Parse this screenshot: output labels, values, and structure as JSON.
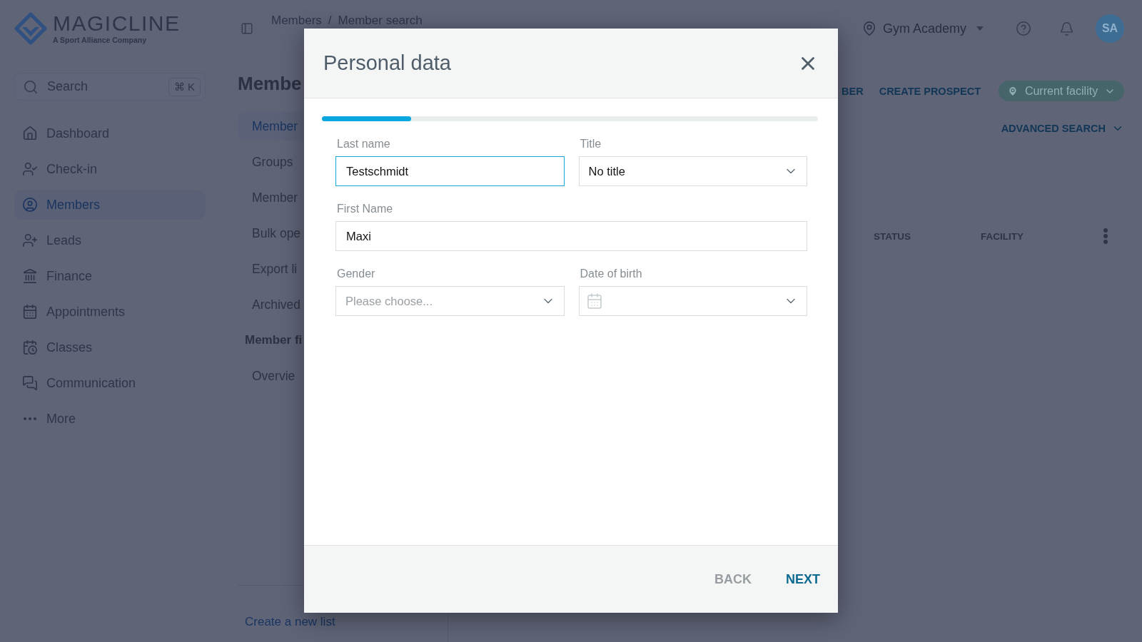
{
  "sidebar": {
    "logo": {
      "name": "MAGICLINE",
      "tagline": "A Sport Alliance Company"
    },
    "search": {
      "placeholder": "Search",
      "shortcut": "⌘ K"
    },
    "items": [
      {
        "label": "Dashboard",
        "selected": false
      },
      {
        "label": "Check-in",
        "selected": false
      },
      {
        "label": "Members",
        "selected": true
      },
      {
        "label": "Leads",
        "selected": false
      },
      {
        "label": "Finance",
        "selected": false
      },
      {
        "label": "Appointments",
        "selected": false
      },
      {
        "label": "Classes",
        "selected": false
      },
      {
        "label": "Communication",
        "selected": false
      },
      {
        "label": "More",
        "selected": false
      }
    ]
  },
  "header": {
    "breadcrumb": {
      "items": [
        "Members",
        "Member search"
      ],
      "separator": "/"
    },
    "facility": "Gym Academy",
    "avatar": "SA"
  },
  "members_panel": {
    "title": "Membe",
    "items": [
      {
        "label": "Member",
        "selected": true
      },
      {
        "label": "Groups",
        "selected": false
      },
      {
        "label": "Member",
        "selected": false
      },
      {
        "label": "Bulk ope",
        "selected": false
      },
      {
        "label": "Export li",
        "selected": false
      },
      {
        "label": "Archived",
        "selected": false
      }
    ],
    "sections": [
      {
        "title": "Member fi",
        "items": [
          {
            "label": "Overvie",
            "selected": false
          }
        ]
      }
    ],
    "footer_link": "Create a new list"
  },
  "toolbar": {
    "actions": [
      "BER",
      "CREATE PROSPECT"
    ],
    "facility_filter": "Current facility",
    "advanced_search": "ADVANCED SEARCH"
  },
  "table": {
    "columns": [
      "STATUS",
      "FACILITY"
    ]
  },
  "dialog": {
    "title": "Personal data",
    "progress": {
      "level": 0.18
    },
    "rows": [
      [
        {
          "kind": "text",
          "label": "Last name",
          "value": "Testschmidt",
          "focused": true
        },
        {
          "kind": "select",
          "label": "Title",
          "value": "No title"
        }
      ],
      [
        {
          "kind": "text",
          "label": "First Name",
          "value": "Maxi",
          "focused": false
        }
      ],
      [
        {
          "kind": "select",
          "label": "Gender",
          "placeholder": "Please choose..."
        },
        {
          "kind": "date",
          "label": "Date of birth"
        }
      ]
    ],
    "buttons": [
      {
        "label": "BACK",
        "disabled": true
      },
      {
        "label": "NEXT",
        "disabled": false
      }
    ]
  }
}
